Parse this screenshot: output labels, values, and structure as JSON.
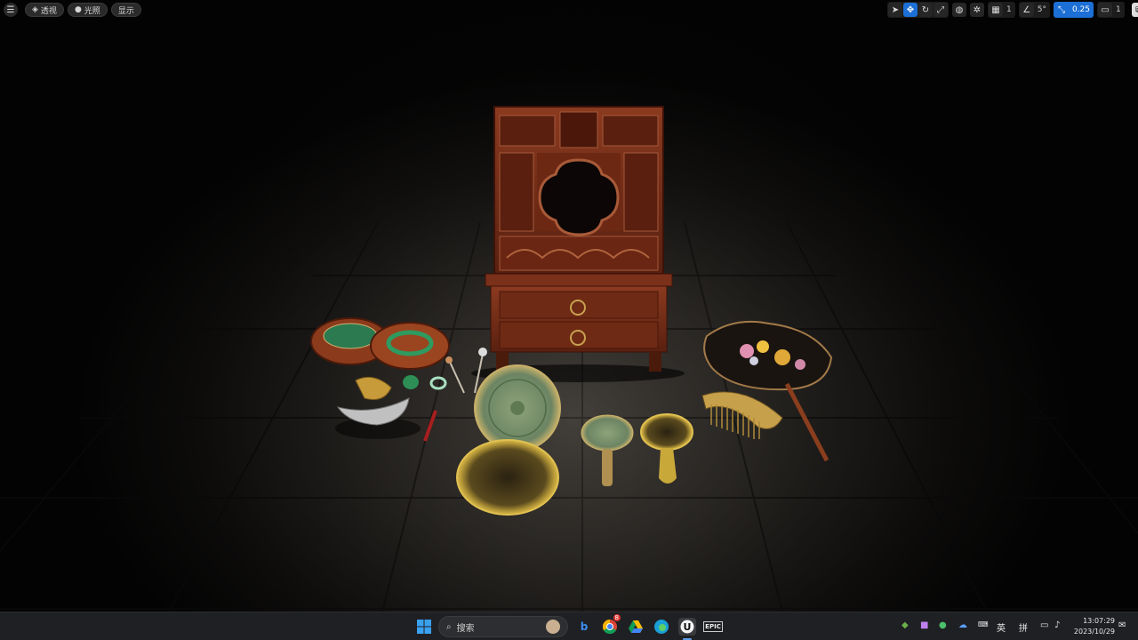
{
  "viewport_toolbar": {
    "menu_icon": "hamburger-icon",
    "perspective_label": "透视",
    "lit_label": "光照",
    "show_label": "显示",
    "grid_size": "1",
    "rotation_snap": "5°",
    "scale_snap": "0.25",
    "camera_speed": "1"
  },
  "taskbar": {
    "search_placeholder": "搜索",
    "chrome_badge": "8",
    "epic_label": "EPIC",
    "ime_lang": "英",
    "ime_mode": "拼",
    "time": "13:07:29",
    "date": "2023/10/29"
  },
  "colors": {
    "accent": "#1c6fd6",
    "wood": "#7a2e18",
    "jade": "#2f8f5a",
    "bronze": "#b8962e"
  }
}
